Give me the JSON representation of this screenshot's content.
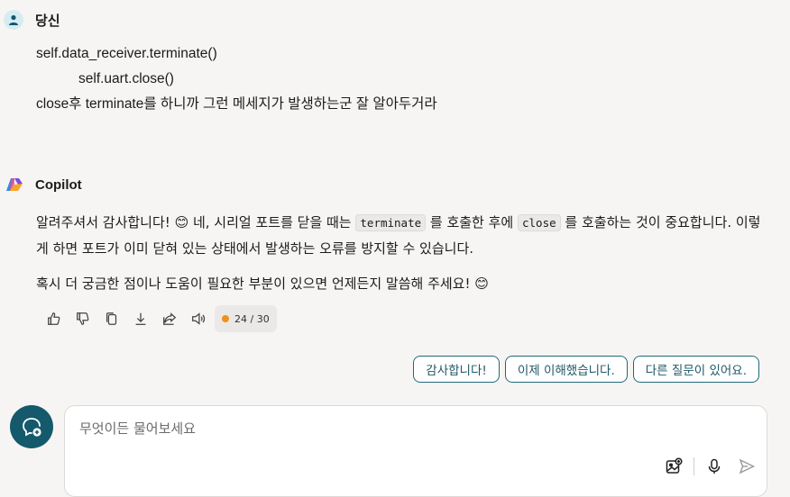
{
  "user": {
    "sender": "당신",
    "lines": [
      "self.data_receiver.terminate()",
      "self.uart.close()",
      "close후 terminate를 하니까 그런 메세지가 발생하는군 잘 알아두거라"
    ]
  },
  "copilot": {
    "sender": "Copilot",
    "p1_a": "알려주셔서 감사합니다! ",
    "p1_b": " 네, 시리얼 포트를 닫을 때는 ",
    "code1": "terminate",
    "p1_c": " 를 호출한 후에 ",
    "code2": "close",
    "p1_d": " 를 호출하는 것이 중요합니다. 이렇게 하면 포트가 이미 닫혀 있는 상태에서 발생하는 오류를 방지할 수 있습니다.",
    "p2_a": "혹시 더 궁금한 점이나 도움이 필요한 부분이 있으면 언제든지 말씀해 주세요! ",
    "emoji": "😊",
    "response_count": "24 / 30"
  },
  "suggestions": [
    "감사합니다!",
    "이제 이해했습니다.",
    "다른 질문이 있어요."
  ],
  "composer": {
    "placeholder": "무엇이든 물어보세요"
  },
  "icons": {
    "user_avatar": "person-icon",
    "copilot_avatar": "copilot-logo-icon",
    "actions": [
      "thumbs-up-icon",
      "thumbs-down-icon",
      "copy-icon",
      "download-icon",
      "share-icon",
      "speaker-icon"
    ],
    "new_chat": "new-chat-icon",
    "composer": [
      "image-add-icon",
      "microphone-icon",
      "send-icon"
    ]
  },
  "colors": {
    "accent": "#14596c",
    "background": "#f7f5f3",
    "count_dot": "#f0901c"
  }
}
